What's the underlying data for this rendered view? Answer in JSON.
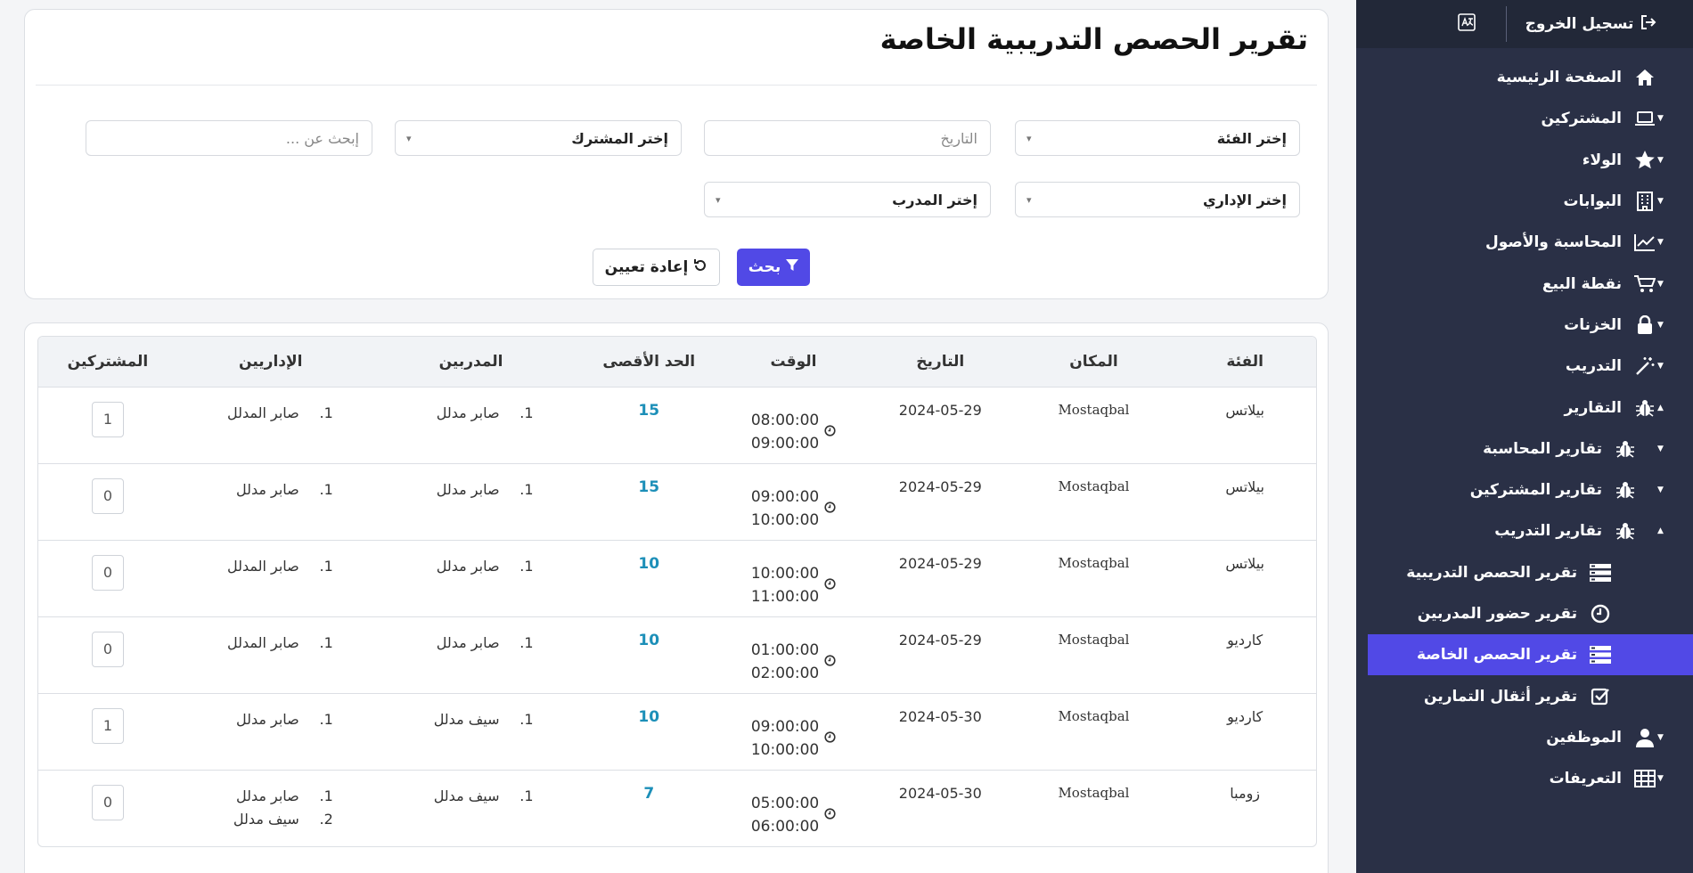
{
  "sidebar": {
    "logout": "تسجيل الخروج",
    "items": [
      {
        "label": "الصفحة الرئيسية",
        "icon": "home-icon",
        "caret": ""
      },
      {
        "label": "المشتركين",
        "icon": "laptop-icon",
        "caret": "▼"
      },
      {
        "label": "الولاء",
        "icon": "star-icon",
        "caret": "▼"
      },
      {
        "label": "البوابات",
        "icon": "building-icon",
        "caret": "▼"
      },
      {
        "label": "المحاسبة والأصول",
        "icon": "chart-line-icon",
        "caret": "▼"
      },
      {
        "label": "نقطة البيع",
        "icon": "cart-icon",
        "caret": "▼"
      },
      {
        "label": "الخزنات",
        "icon": "lock-icon",
        "caret": "▼"
      },
      {
        "label": "التدريب",
        "icon": "wand-icon",
        "caret": "▼"
      },
      {
        "label": "التقارير",
        "icon": "bug-icon",
        "caret": "▲"
      },
      {
        "label": "تقارير المحاسبة",
        "icon": "bug-icon",
        "caret": "▼"
      },
      {
        "label": "تقارير المشتركين",
        "icon": "bug-icon",
        "caret": "▼"
      },
      {
        "label": "تقارير التدريب",
        "icon": "bug-icon",
        "caret": "▲"
      },
      {
        "label": "تقرير الحصص التدريبية",
        "icon": "tasks-icon",
        "caret": ""
      },
      {
        "label": "تقرير حضور المدربين",
        "icon": "clock-icon",
        "caret": ""
      },
      {
        "label": "تقرير الحصص الخاصة",
        "icon": "tasks-icon",
        "caret": ""
      },
      {
        "label": "تقرير أثقال التمارين",
        "icon": "check-square-icon",
        "caret": ""
      },
      {
        "label": "الموظفين",
        "icon": "user-icon",
        "caret": "▼"
      },
      {
        "label": "التعريفات",
        "icon": "table-icon",
        "caret": "▼"
      }
    ]
  },
  "page": {
    "title": "تقرير الحصص التدريبية الخاصة"
  },
  "filters": {
    "category": "إختر الفئة",
    "date_placeholder": "التاريخ",
    "member": "إختر المشترك",
    "search_placeholder": "إبحث عن ...",
    "admin": "إختر الإداري",
    "trainer": "إختر المدرب",
    "search_btn": "بحث",
    "reset_btn": "إعادة تعيين"
  },
  "table": {
    "headers": [
      "الفئة",
      "المكان",
      "التاريخ",
      "الوقت",
      "الحد الأقصى",
      "المدربين",
      "الإداريين",
      "المشتركين"
    ],
    "rows": [
      {
        "category": "بيلاتس",
        "place": "Mostaqbal",
        "date": "2024-05-29",
        "start": "08:00:00",
        "end": "09:00:00",
        "max": "15",
        "trainers": [
          "صابر مدلل"
        ],
        "admins": [
          "صابر المدلل"
        ],
        "members": "1"
      },
      {
        "category": "بيلاتس",
        "place": "Mostaqbal",
        "date": "2024-05-29",
        "start": "09:00:00",
        "end": "10:00:00",
        "max": "15",
        "trainers": [
          "صابر مدلل"
        ],
        "admins": [
          "صابر مدلل"
        ],
        "members": "0"
      },
      {
        "category": "بيلاتس",
        "place": "Mostaqbal",
        "date": "2024-05-29",
        "start": "10:00:00",
        "end": "11:00:00",
        "max": "10",
        "trainers": [
          "صابر مدلل"
        ],
        "admins": [
          "صابر المدلل"
        ],
        "members": "0"
      },
      {
        "category": "كارديو",
        "place": "Mostaqbal",
        "date": "2024-05-29",
        "start": "01:00:00",
        "end": "02:00:00",
        "max": "10",
        "trainers": [
          "صابر مدلل"
        ],
        "admins": [
          "صابر المدلل"
        ],
        "members": "0"
      },
      {
        "category": "كارديو",
        "place": "Mostaqbal",
        "date": "2024-05-30",
        "start": "09:00:00",
        "end": "10:00:00",
        "max": "10",
        "trainers": [
          "سيف مدلل"
        ],
        "admins": [
          "صابر مدلل"
        ],
        "members": "1"
      },
      {
        "category": "زومبا",
        "place": "Mostaqbal",
        "date": "2024-05-30",
        "start": "05:00:00",
        "end": "06:00:00",
        "max": "7",
        "trainers": [
          "سيف مدلل"
        ],
        "admins": [
          "صابر مدلل",
          "سيف مدلل"
        ],
        "members": "0"
      }
    ]
  },
  "colors": {
    "sidebar_bg": "#2a3046",
    "accent": "#5149e6",
    "max_value": "#1c8fb8"
  }
}
